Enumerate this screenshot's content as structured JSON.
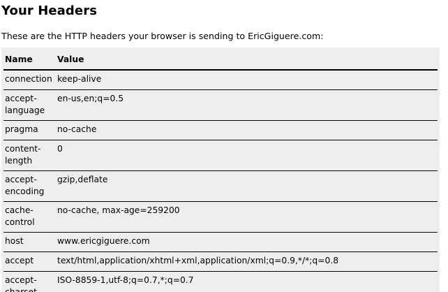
{
  "page": {
    "title": "Your Headers",
    "intro": "These are the HTTP headers your browser is sending to EricGiguere.com:"
  },
  "table": {
    "headers": [
      "Name",
      "Value"
    ],
    "rows": [
      {
        "name": "connection",
        "value": "keep-alive"
      },
      {
        "name": "accept-language",
        "value": "en-us,en;q=0.5"
      },
      {
        "name": "pragma",
        "value": "no-cache"
      },
      {
        "name": "content-length",
        "value": "0"
      },
      {
        "name": "accept-encoding",
        "value": "gzip,deflate"
      },
      {
        "name": "cache-control",
        "value": "no-cache, max-age=259200"
      },
      {
        "name": "host",
        "value": "www.ericgiguere.com"
      },
      {
        "name": "accept",
        "value": "text/html,application/xhtml+xml,application/xml;q=0.9,*/*;q=0.8"
      },
      {
        "name": "accept-charset",
        "value": "ISO-8859-1,utf-8;q=0.7,*;q=0.7"
      }
    ]
  }
}
